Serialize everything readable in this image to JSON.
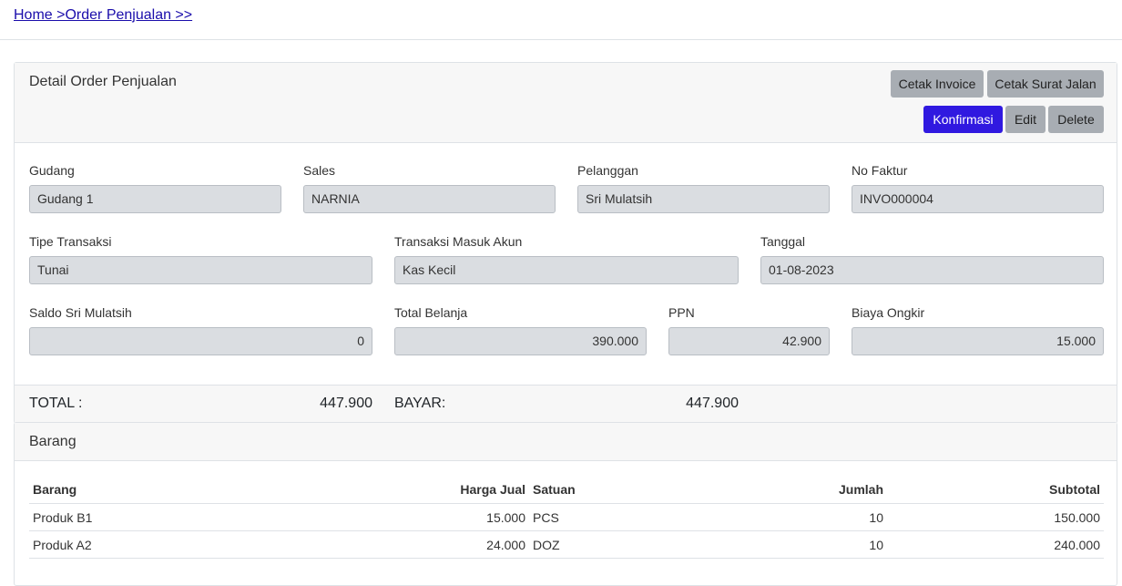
{
  "breadcrumb": {
    "text": "Home >Order Penjualan >>"
  },
  "detail": {
    "title": "Detail Order Penjualan",
    "buttons": {
      "cetak_invoice": "Cetak Invoice",
      "cetak_surat_jalan": "Cetak Surat Jalan",
      "konfirmasi": "Konfirmasi",
      "edit": "Edit",
      "delete": "Delete"
    },
    "fields": {
      "gudang": {
        "label": "Gudang",
        "value": "Gudang 1"
      },
      "sales": {
        "label": "Sales",
        "value": "NARNIA"
      },
      "pelanggan": {
        "label": "Pelanggan",
        "value": "Sri Mulatsih"
      },
      "no_faktur": {
        "label": "No Faktur",
        "value": "INVO000004"
      },
      "tipe_transaksi": {
        "label": "Tipe Transaksi",
        "value": "Tunai"
      },
      "transaksi_akun": {
        "label": "Transaksi Masuk Akun",
        "value": "Kas Kecil"
      },
      "tanggal": {
        "label": "Tanggal",
        "value": "01-08-2023"
      },
      "saldo": {
        "label": "Saldo Sri Mulatsih",
        "value": "0"
      },
      "total_belanja": {
        "label": "Total Belanja",
        "value": "390.000"
      },
      "ppn": {
        "label": "PPN",
        "value": "42.900"
      },
      "biaya_ongkir": {
        "label": "Biaya Ongkir",
        "value": "15.000"
      }
    },
    "footer": {
      "total_label": "TOTAL :",
      "total_value": "447.900",
      "bayar_label": "BAYAR:",
      "bayar_value": "447.900"
    }
  },
  "items": {
    "title": "Barang",
    "headers": [
      "Barang",
      "Harga Jual",
      "Satuan",
      "Jumlah",
      "Subtotal"
    ],
    "rows": [
      [
        "Produk B1",
        "15.000",
        "PCS",
        "10",
        "150.000"
      ],
      [
        "Produk A2",
        "24.000",
        "DOZ",
        "10",
        "240.000"
      ]
    ]
  },
  "colors": {
    "primary_button": "#3019e0",
    "secondary_button": "#a8adb3",
    "link": "#1a0dab"
  }
}
